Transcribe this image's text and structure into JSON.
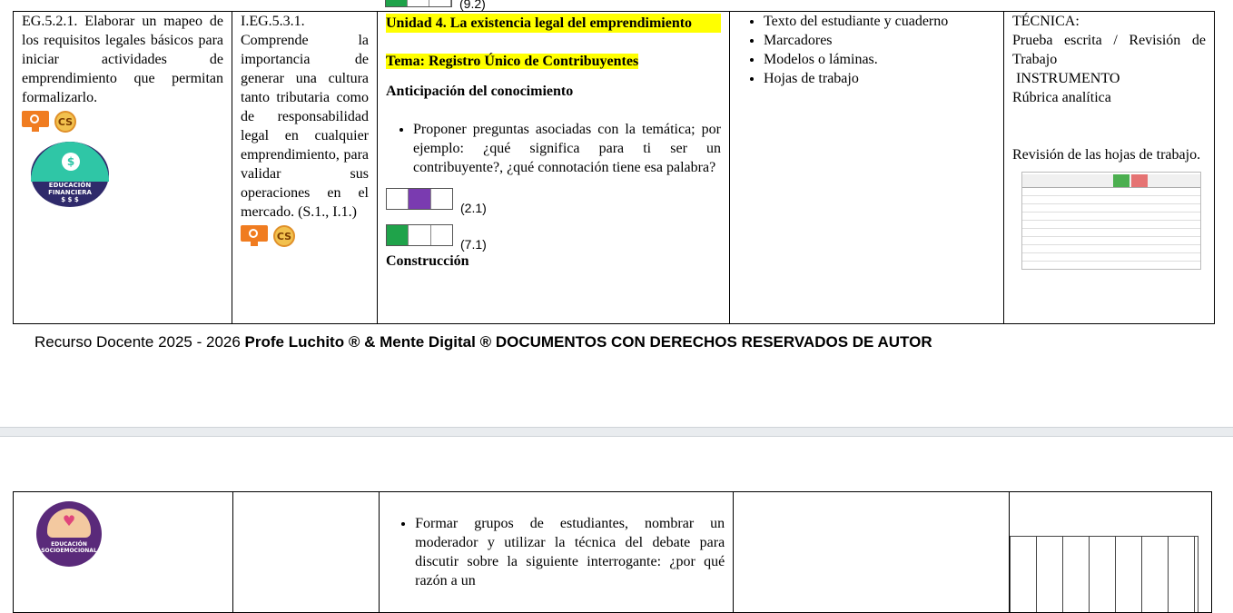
{
  "page1": {
    "top_bar_code": "(9.2)",
    "row": {
      "destreza": "EG.5.2.1. Elaborar un mapeo de los requisitos legales básicos para iniciar actividades de emprendimiento que permitan formalizarlo.",
      "indicador": "I.EG.5.3.1. Comprende la importancia de generar una cultura tanto tributaria como de responsabilidad legal en cualquier emprendimiento, para validar sus operaciones en el mercado. (S.1., I.1.)",
      "unidad": "Unidad 4. La existencia legal del emprendimiento",
      "tema": "Tema: Registro Único de Contribuyentes",
      "anticipacion_title": "Anticipación del conocimiento",
      "anticipacion_item": "Proponer preguntas asociadas con la temática; por ejemplo: ¿qué significa para ti ser un contribuyente?, ¿qué connotación tiene esa palabra?",
      "bar1_code": "(2.1)",
      "bar2_code": "(7.1)",
      "construccion_title": "Construcción",
      "materiales": [
        "Texto del estudiante y cuaderno",
        "Marcadores",
        "Modelos o láminas.",
        "Hojas de trabajo"
      ],
      "evaluacion_tecnica_label": "TÉCNICA:",
      "evaluacion_tecnica": "Prueba escrita / Revisión de Trabajo",
      "evaluacion_instrumento_label": "INSTRUMENTO",
      "evaluacion_instrumento": "Rúbrica analítica",
      "evaluacion_revision": "Revisión de las hojas de trabajo.",
      "badge_label": "EDUCACIÓN FINANCIERA",
      "badge_sub": "$ $ $"
    },
    "footer_normal": "Recurso Docente 2025 - 2026 ",
    "footer_bold": "Profe Luchito ® & Mente Digital ® DOCUMENTOS CON DERECHOS RESERVADOS DE AUTOR"
  },
  "page2": {
    "badge_label": "EDUCACIÓN SOCIOEMOCIONAL",
    "actividad": "Formar grupos de estudiantes, nombrar un moderador y utilizar la técnica del debate para discutir sobre la siguiente interrogante: ¿por qué razón a un"
  },
  "icons": {
    "monitor": "monitor-icon",
    "cs": "cs-icon",
    "cs_text": "CS"
  },
  "colors": {
    "highlight": "#ffff00",
    "bar_green": "#1fa34a",
    "bar_purple": "#7a3bb0"
  }
}
